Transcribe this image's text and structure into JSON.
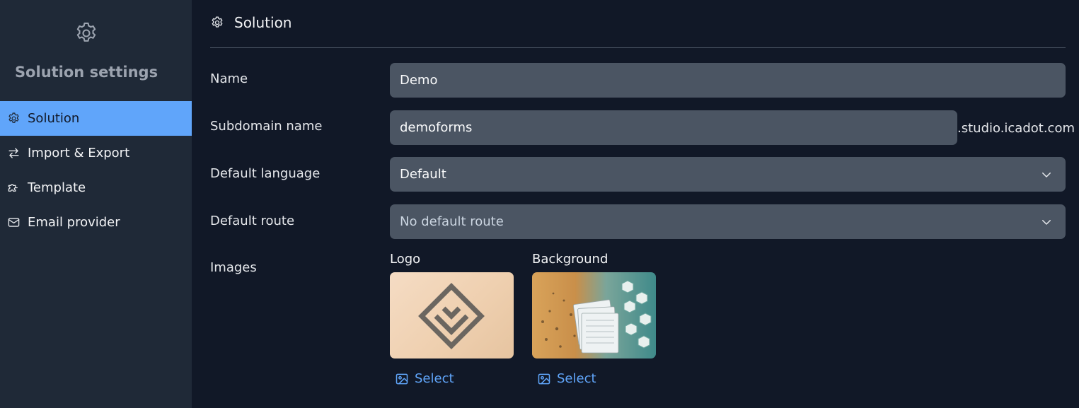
{
  "sidebar": {
    "title": "Solution settings",
    "header_icon": "gear-icon",
    "items": [
      {
        "label": "Solution",
        "icon": "gear-icon",
        "active": true
      },
      {
        "label": "Import & Export",
        "icon": "arrows-swap-icon",
        "active": false
      },
      {
        "label": "Template",
        "icon": "puzzle-icon",
        "active": false
      },
      {
        "label": "Email provider",
        "icon": "envelope-icon",
        "active": false
      }
    ]
  },
  "page": {
    "title": "Solution",
    "icon": "gear-icon"
  },
  "form": {
    "name_label": "Name",
    "name_value": "Demo",
    "subdomain_label": "Subdomain name",
    "subdomain_value": "demoforms",
    "subdomain_suffix": ".studio.icadot.com",
    "language_label": "Default language",
    "language_value": "Default",
    "route_label": "Default route",
    "route_value": "No default route",
    "images_label": "Images",
    "logo_label": "Logo",
    "background_label": "Background",
    "select_label": "Select"
  },
  "colors": {
    "accent": "#60a5fa",
    "sidebar_bg": "#1f2937",
    "main_bg": "#111827",
    "field_bg": "#4b5563"
  }
}
